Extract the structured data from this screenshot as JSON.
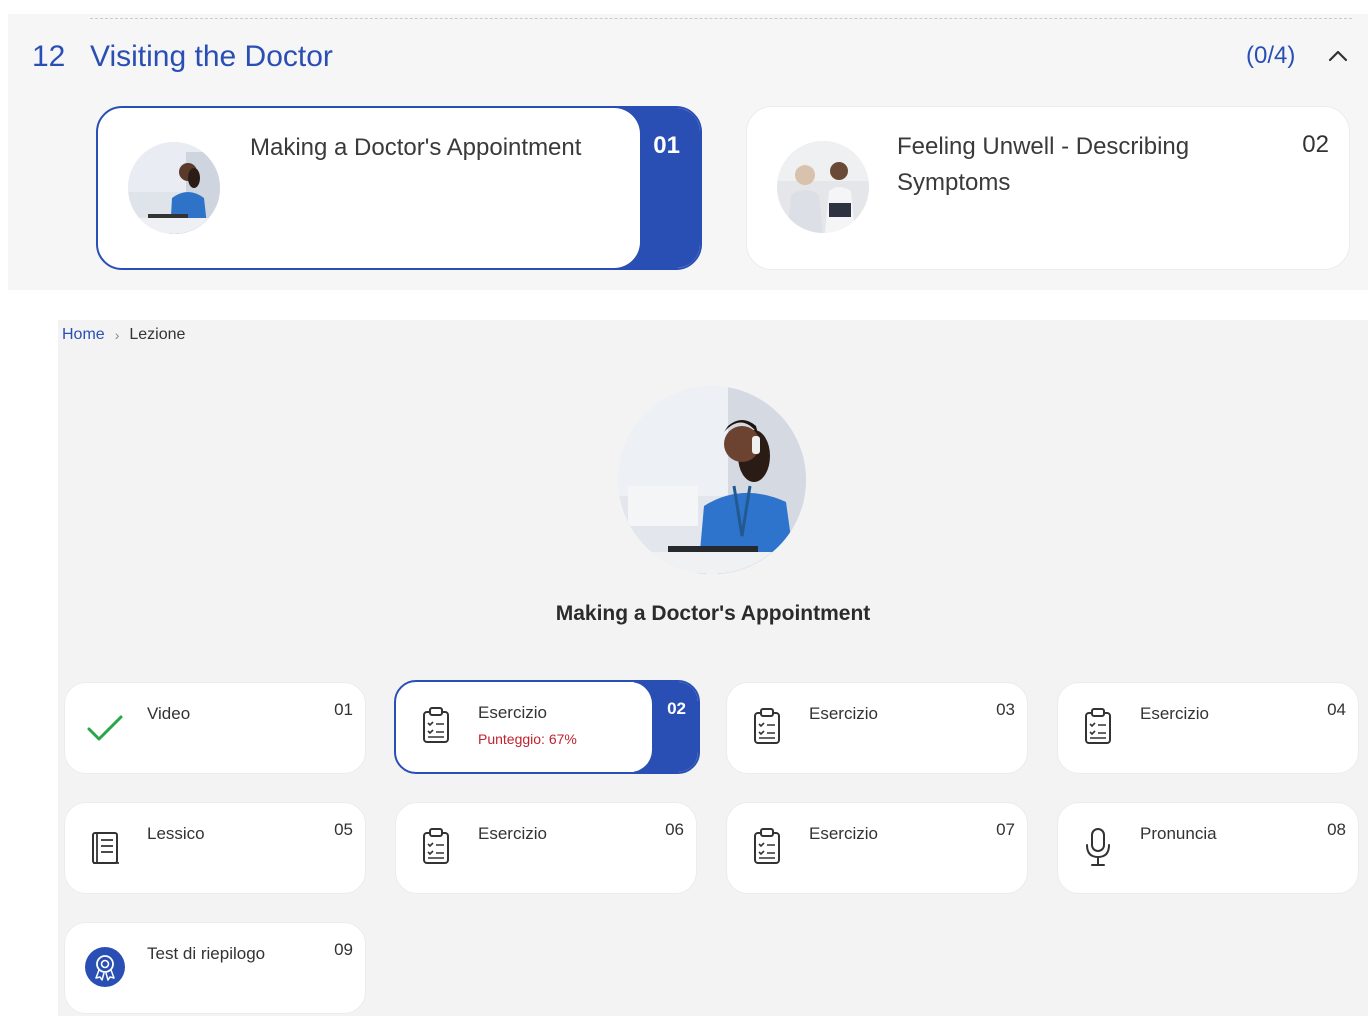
{
  "section": {
    "number": "12",
    "title": "Visiting the Doctor",
    "progress": "(0/4)",
    "colors": {
      "accent": "#2a4fb4"
    }
  },
  "lessons": [
    {
      "title": "Making a Doctor's Appointment",
      "number": "01",
      "active": true
    },
    {
      "title": "Feeling Unwell - Describing Symptoms",
      "number": "02",
      "active": false
    }
  ],
  "breadcrumb": {
    "home": "Home",
    "current": "Lezione"
  },
  "lesson_detail": {
    "title": "Making a Doctor's Appointment"
  },
  "activities": [
    {
      "label": "Video",
      "number": "01",
      "icon": "check-icon",
      "completed": true
    },
    {
      "label": "Esercizio",
      "number": "02",
      "icon": "clipboard-icon",
      "score": "Punteggio: 67%",
      "active": true
    },
    {
      "label": "Esercizio",
      "number": "03",
      "icon": "clipboard-icon"
    },
    {
      "label": "Esercizio",
      "number": "04",
      "icon": "clipboard-icon"
    },
    {
      "label": "Lessico",
      "number": "05",
      "icon": "book-icon"
    },
    {
      "label": "Esercizio",
      "number": "06",
      "icon": "clipboard-icon"
    },
    {
      "label": "Esercizio",
      "number": "07",
      "icon": "clipboard-icon"
    },
    {
      "label": "Pronuncia",
      "number": "08",
      "icon": "microphone-icon"
    },
    {
      "label": "Test di riepilogo",
      "number": "09",
      "icon": "award-badge-icon"
    }
  ]
}
